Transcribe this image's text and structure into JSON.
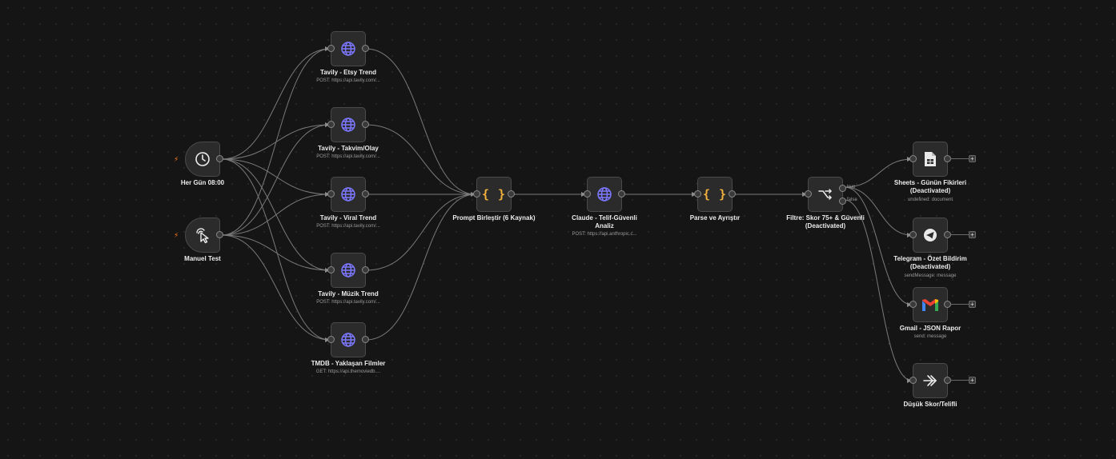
{
  "colors": {
    "canvas": "#151515",
    "node_bg": "#2b2b2b",
    "node_border": "#4a4a4a",
    "edge": "#8c8c8c",
    "http_icon": "#7c78ff",
    "code_icon": "#f2b13c",
    "trigger_bolt": "#ff7a1a"
  },
  "nodes": {
    "schedule": {
      "label": "Her Gün 08:00",
      "icon": "clock-icon"
    },
    "manual": {
      "label": "Manuel Test",
      "icon": "cursor-click-icon"
    },
    "etsy": {
      "label": "Tavily - Etsy Trend",
      "sub": "POST: https://api.tavily.com/...",
      "icon": "globe-icon"
    },
    "takvim": {
      "label": "Tavily - Takvim/Olay",
      "sub": "POST: https://api.tavily.com/...",
      "icon": "globe-icon"
    },
    "viral": {
      "label": "Tavily - Viral Trend",
      "sub": "POST: https://api.tavily.com/...",
      "icon": "globe-icon"
    },
    "muzik": {
      "label": "Tavily - Müzik Trend",
      "sub": "POST: https://api.tavily.com/...",
      "icon": "globe-icon"
    },
    "tmdb": {
      "label": "TMDB - Yaklaşan Filmler",
      "sub": "GET: https://api.themoviedb....",
      "icon": "globe-icon"
    },
    "prompt": {
      "label": "Prompt Birleştir (6 Kaynak)",
      "icon": "braces-icon",
      "glyph": "{ }"
    },
    "claude": {
      "label": "Claude - Telif-Güvenli Analiz",
      "sub": "POST: https://api.anthropic.c...",
      "icon": "globe-icon"
    },
    "parse": {
      "label": "Parse ve Ayrıştır",
      "icon": "braces-icon",
      "glyph": "{ }"
    },
    "filtre": {
      "label": "Filtre: Skor 75+ & Güvenli (Deactivated)",
      "icon": "branch-icon",
      "out_true": "true",
      "out_false": "false"
    },
    "sheets": {
      "label": "Sheets - Günün Fikirleri (Deactivated)",
      "sub": "undefined: document",
      "icon": "sheets-icon"
    },
    "telegram": {
      "label": "Telegram - Özet Bildirim (Deactivated)",
      "sub": "sendMessage: message",
      "icon": "telegram-icon"
    },
    "gmail": {
      "label": "Gmail - JSON Rapor",
      "sub": "send: message",
      "icon": "gmail-icon",
      "colors": [
        "#4285F4",
        "#EA4335",
        "#FBBC05",
        "#34A853"
      ]
    },
    "dusuk": {
      "label": "Düşük Skor/Telifli",
      "icon": "no-op-arrow-icon"
    }
  },
  "ui": {
    "add_glyph": "+",
    "bolt_glyph": "⚡"
  }
}
